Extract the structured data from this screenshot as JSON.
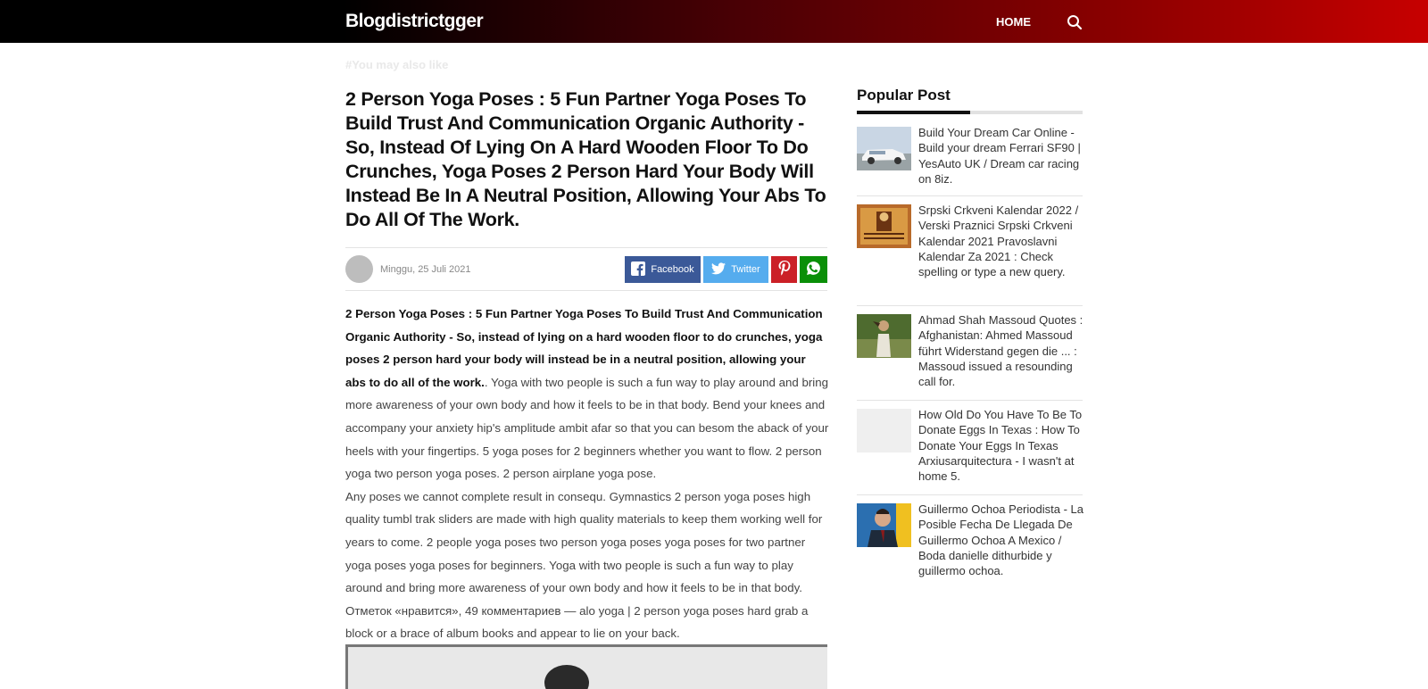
{
  "header": {
    "brand": "Blogdistrictgger",
    "nav": {
      "home_label": "HOME"
    },
    "gradient_colors": [
      "#000000",
      "#4a0005",
      "#c70000"
    ]
  },
  "you_may_also_like": "#You may also like",
  "post": {
    "title": "2 Person Yoga Poses : 5 Fun Partner Yoga Poses To Build Trust And Communication Organic Authority - So, Instead Of Lying On A Hard Wooden Floor To Do Crunches, Yoga Poses 2 Person Hard Your Body Will Instead Be In A Neutral Position, Allowing Your Abs To Do All Of The Work.",
    "date": "Minggu, 25 Juli 2021",
    "share": {
      "facebook_label": "Facebook",
      "twitter_label": "Twitter",
      "colors": {
        "facebook": "#3b5998",
        "twitter": "#55acee",
        "pinterest": "#cb2027",
        "whatsapp": "#0a8f08"
      }
    },
    "lead_bold": "2 Person Yoga Poses : 5 Fun Partner Yoga Poses To Build Trust And Communication Organic Authority - So, instead of lying on a hard wooden floor to do crunches, yoga poses 2 person hard your body will instead be in a neutral position, allowing your abs to do all of the work.",
    "lead_rest": ". Yoga with two people is such a fun way to play around and bring more awareness of your own body and how it feels to be in that body. Bend your knees and accompany your anxiety hip's amplitude ambit afar so that you can besom the aback of your heels with your fingertips. 5 yoga poses for 2 beginners whether you want to flow. 2 person yoga two person yoga poses. 2 person airplane yoga pose.",
    "paragraph2": "Any poses we cannot complete result in consequ. Gymnastics 2 person yoga poses high quality tumbl trak sliders are made with high quality materials to keep them working well for years to come. 2 people yoga poses two person yoga poses yoga poses for two partner yoga poses yoga poses for beginners. Yoga with two people is such a fun way to play around and bring more awareness of your own body and how it feels to be in that body. Отметок «нравится», 49 комментариев — alo yoga | 2 person yoga poses hard grab a block or a brace of album books and appear to lie on your back."
  },
  "sidebar": {
    "title": "Popular Post",
    "items": [
      {
        "text": "Build Your Dream Car Online - Build your dream Ferrari SF90 | YesAuto UK / Dream car racing on 8iz."
      },
      {
        "text": "Srpski Crkveni Kalendar 2022 / Verski Praznici Srpski Crkveni Kalendar 2021 Pravoslavni Kalendar Za 2021 : Check spelling or type a new query."
      },
      {
        "text": "Ahmad Shah Massoud Quotes : Afghanistan: Ahmed Massoud führt Widerstand gegen die ... : Massoud issued a resounding call for."
      },
      {
        "text": "How Old Do You Have To Be To Donate Eggs In Texas : How To Donate Your Eggs In Texas Arxiusarquitectura - I wasn't at home 5."
      },
      {
        "text": "Guillermo Ochoa Periodista - La Posible Fecha De Llegada De Guillermo Ochoa A Mexico / Boda danielle dithurbide y guillermo ochoa."
      }
    ]
  }
}
